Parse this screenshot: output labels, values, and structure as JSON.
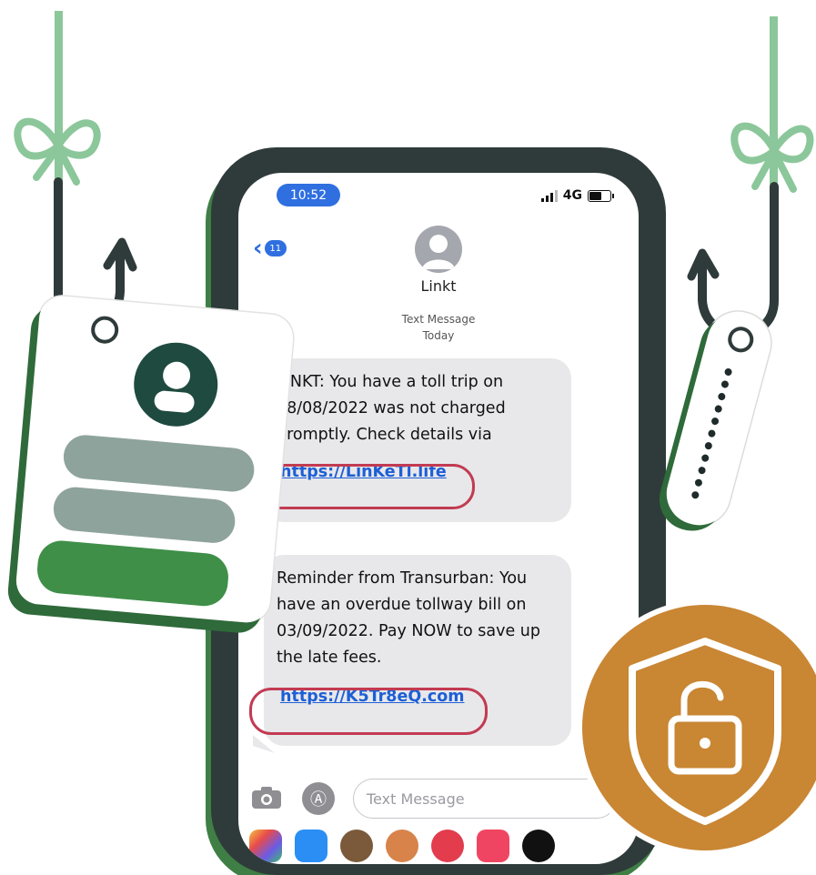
{
  "status_bar": {
    "time": "10:52",
    "network": "4G"
  },
  "header": {
    "back_count": "11",
    "contact_name": "Linkt"
  },
  "thread": {
    "label": "Text Message",
    "date": "Today"
  },
  "messages": [
    {
      "text": "LINKT: You have a toll trip on 28/08/2022 was not charged promptly. Check details via",
      "link": "https://LinKeTl.life"
    },
    {
      "text": "Reminder from Transurban: You have an overdue tollway bill on 03/09/2022. Pay NOW to save up the late fees.",
      "link": "https://K5Tr8eQ.com"
    }
  ],
  "input": {
    "placeholder": "Text Message"
  },
  "colors": {
    "accent_blue": "#2f6fe0",
    "warning_red": "#c23b52",
    "brand_green": "#3f8f48",
    "shield_orange": "#c98633",
    "hook_line": "#8bc79a"
  },
  "icons": [
    "user-icon",
    "camera-icon",
    "app-store-icon",
    "unlock-shield-icon",
    "fishing-hook-icon"
  ]
}
